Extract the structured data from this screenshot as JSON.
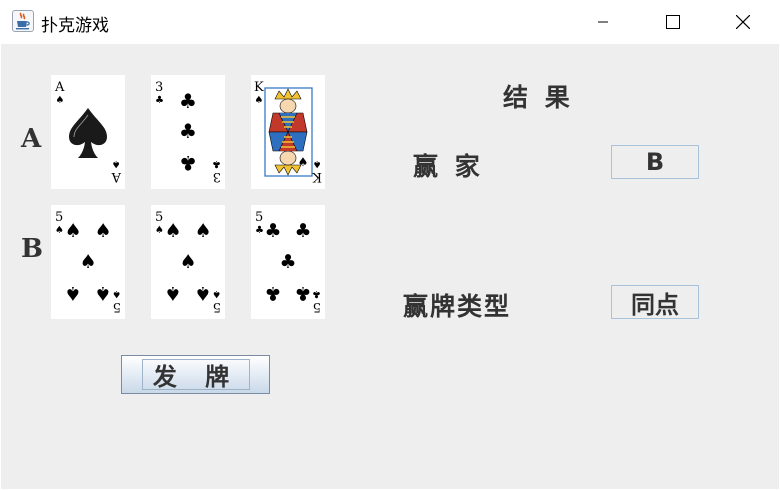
{
  "window": {
    "title": "扑克游戏",
    "icon": "java-cup-icon",
    "controls": [
      "minimize",
      "maximize",
      "close"
    ]
  },
  "players": [
    {
      "label": "A",
      "cards": [
        {
          "rank": "A",
          "suit": "spades",
          "pips": 1,
          "color": "#000000"
        },
        {
          "rank": "3",
          "suit": "clubs",
          "pips": 3,
          "color": "#000000"
        },
        {
          "rank": "K",
          "suit": "spades",
          "pips": 0,
          "face": true,
          "color": "#000000"
        }
      ]
    },
    {
      "label": "B",
      "cards": [
        {
          "rank": "5",
          "suit": "spades",
          "pips": 5,
          "color": "#000000"
        },
        {
          "rank": "5",
          "suit": "spades",
          "pips": 5,
          "color": "#000000"
        },
        {
          "rank": "5",
          "suit": "clubs",
          "pips": 5,
          "color": "#000000"
        }
      ]
    }
  ],
  "result": {
    "title": "结 果",
    "winner_label": "赢 家",
    "winner_value": "B",
    "hand_type_label": "赢牌类型",
    "hand_type_value": "同点"
  },
  "deal_button": "发 牌"
}
